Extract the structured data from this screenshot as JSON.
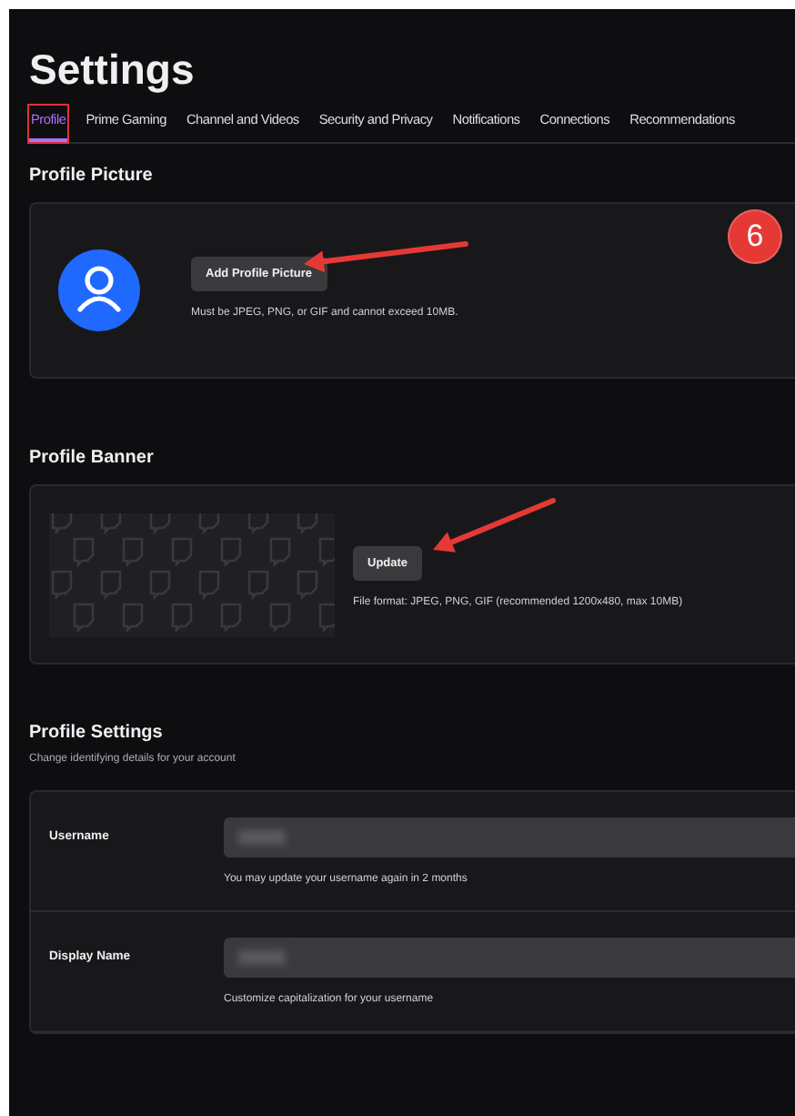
{
  "title": "Settings",
  "tabs": [
    {
      "label": "Profile",
      "selected": true,
      "outlined": true
    },
    {
      "label": "Prime Gaming",
      "selected": false,
      "outlined": false
    },
    {
      "label": "Channel and Videos",
      "selected": false,
      "outlined": false
    },
    {
      "label": "Security and Privacy",
      "selected": false,
      "outlined": false
    },
    {
      "label": "Notifications",
      "selected": false,
      "outlined": false
    },
    {
      "label": "Connections",
      "selected": false,
      "outlined": false
    },
    {
      "label": "Recommendations",
      "selected": false,
      "outlined": false
    }
  ],
  "sections": [
    {
      "kind": "avatar",
      "heading": "Profile Picture",
      "button": "Add Profile Picture",
      "note": "Must be JPEG, PNG, or GIF and cannot exceed 10MB.",
      "arrow": true,
      "step": "6"
    },
    {
      "kind": "banner",
      "heading": "Profile Banner",
      "button": "Update",
      "note": "File format: JPEG, PNG, GIF (recommended 1200x480, max 10MB)",
      "arrow": true
    }
  ],
  "profile_settings": {
    "heading": "Profile Settings",
    "subtitle": "Change identifying details for your account",
    "fields": [
      {
        "label": "Username",
        "note": "You may update your username again in 2 months"
      },
      {
        "label": "Display Name",
        "note": "Customize capitalization for your username"
      }
    ]
  }
}
